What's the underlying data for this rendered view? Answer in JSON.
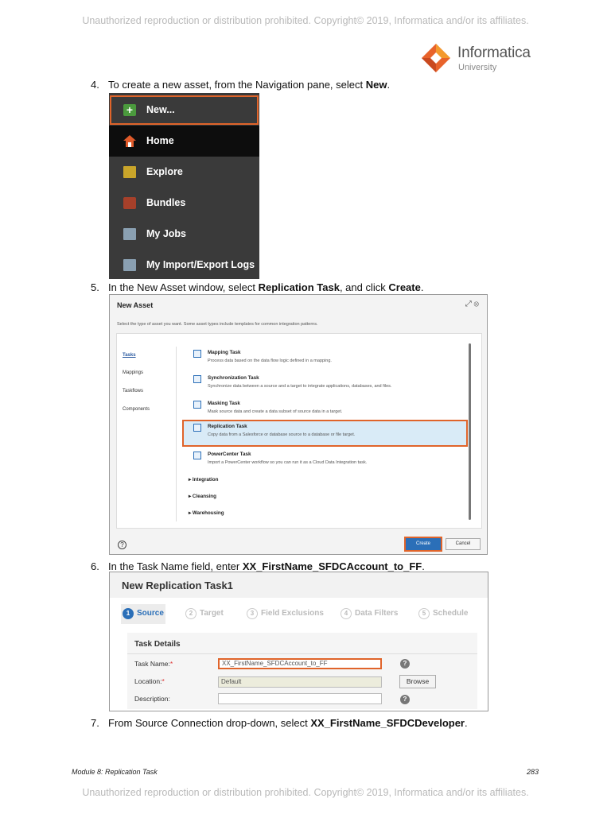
{
  "copyright": "Unauthorized reproduction or distribution prohibited. Copyright© 2019, Informatica and/or its affiliates.",
  "logo": {
    "brand": "Informatica",
    "sub": "University",
    "icon": "informatica-diamond-logo"
  },
  "steps": [
    {
      "num": "4.",
      "pre": "To create a new asset, from the Navigation pane, select ",
      "bold": "New",
      "post": "."
    },
    {
      "num": "5.",
      "pre": "In the New Asset window, select ",
      "bold": "Replication Task",
      "mid": ", and click ",
      "bold2": "Create",
      "post": "."
    },
    {
      "num": "6.",
      "pre": "In the Task Name field, enter ",
      "bold": "XX_FirstName_SFDCAccount_to_FF",
      "post": "."
    },
    {
      "num": "7.",
      "pre": "From Source Connection drop-down, select ",
      "bold": "XX_FirstName_SFDCDeveloper",
      "post": "."
    }
  ],
  "nav": {
    "items": [
      {
        "label": "New...",
        "icon": "plus-icon"
      },
      {
        "label": "Home",
        "icon": "home-icon"
      },
      {
        "label": "Explore",
        "icon": "folder-icon"
      },
      {
        "label": "Bundles",
        "icon": "bundle-icon"
      },
      {
        "label": "My Jobs",
        "icon": "jobs-icon"
      },
      {
        "label": "My Import/Export Logs",
        "icon": "logs-icon"
      }
    ]
  },
  "new_asset": {
    "title": "New Asset",
    "window_controls": "⤢ ⊗",
    "description": "Select the type of asset you want. Some asset types include templates for common integration patterns.",
    "categories": [
      "Tasks",
      "Mappings",
      "Taskflows",
      "Components"
    ],
    "tasks": [
      {
        "name": "Mapping Task",
        "desc": "Process data based on the data flow logic defined in a mapping."
      },
      {
        "name": "Synchronization Task",
        "desc": "Synchronize data between a source and a target to integrate applications, databases, and files."
      },
      {
        "name": "Masking Task",
        "desc": "Mask source data and create a data subset of source data in a target."
      },
      {
        "name": "Replication Task",
        "desc": "Copy data from a Salesforce or database source to a database or file target."
      },
      {
        "name": "PowerCenter Task",
        "desc": "Import a PowerCenter workflow so you can run it as a Cloud Data Integration task."
      }
    ],
    "groups": [
      "▸ Integration",
      "▸ Cleansing",
      "▸ Warehousing"
    ],
    "help": "?",
    "create_label": "Create",
    "cancel_label": "Cancel"
  },
  "replication": {
    "title": "New Replication Task1",
    "wizard": [
      {
        "num": "1",
        "label": "Source"
      },
      {
        "num": "2",
        "label": "Target"
      },
      {
        "num": "3",
        "label": "Field Exclusions"
      },
      {
        "num": "4",
        "label": "Data Filters"
      },
      {
        "num": "5",
        "label": "Schedule"
      }
    ],
    "details_title": "Task Details",
    "fields": {
      "task_name_label": "Task Name:",
      "task_name_value": "XX_FirstName_SFDCAccount_to_FF",
      "location_label": "Location:",
      "location_value": "Default",
      "description_label": "Description:",
      "description_value": "",
      "required_mark": "*",
      "help": "?",
      "browse_label": "Browse"
    }
  },
  "footer": {
    "module": "Module 8: Replication Task",
    "page": "283"
  }
}
